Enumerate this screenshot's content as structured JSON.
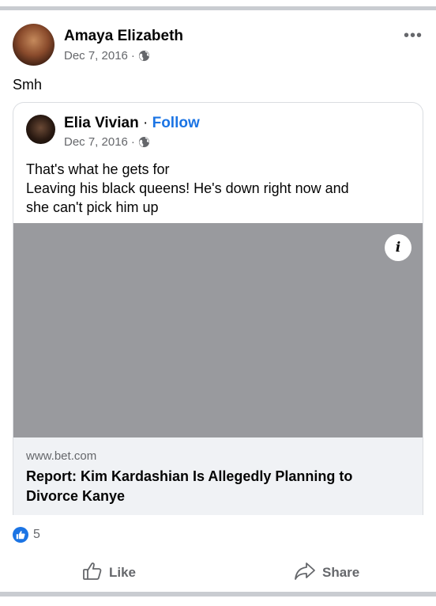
{
  "post": {
    "author": "Amaya Elizabeth",
    "date": "Dec 7, 2016",
    "separator": "·",
    "audience_icon": "globe-icon",
    "more_icon": "more-options-icon",
    "more_label": "•••",
    "text": "Smh"
  },
  "shared": {
    "author": "Elia Vivian",
    "separator": "·",
    "follow_label": "Follow",
    "date": "Dec 7, 2016",
    "audience_icon": "globe-icon",
    "text_lines": [
      "That's what he gets for",
      "Leaving his black queens! He's down right now and",
      "she can't pick him up"
    ],
    "link": {
      "image_color": "#999a9e",
      "info_label": "i",
      "domain": "www.bet.com",
      "title": "Report: Kim Kardashian Is Allegedly Planning to Divorce Kanye"
    }
  },
  "reactions": {
    "icon": "like-reaction-icon",
    "count": "5"
  },
  "actions": {
    "like_label": "Like",
    "like_icon": "thumbs-up-icon",
    "share_label": "Share",
    "share_icon": "share-arrow-icon"
  },
  "colors": {
    "accent": "#1b74e4",
    "secondary_text": "#65676b",
    "divider": "#c9ccd1",
    "link_bg": "#f0f2f5"
  }
}
